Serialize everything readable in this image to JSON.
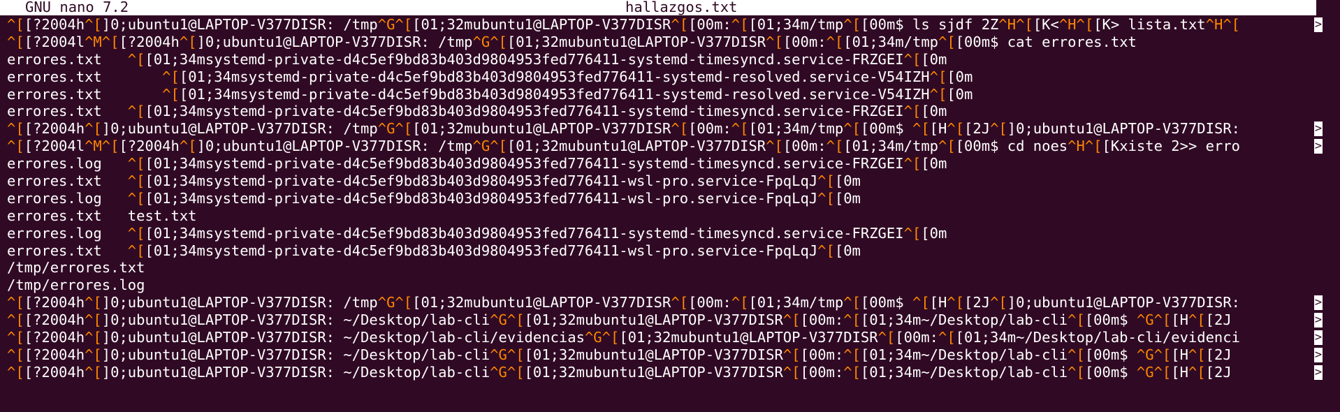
{
  "header": {
    "app": "GNU nano 7.2",
    "filename": "hallazgos.txt"
  },
  "overflow_marker": ">",
  "colors": {
    "background": "#300a24",
    "text": "#ffffff",
    "control_char": "#ff8700",
    "titlebar": "#ffffff"
  },
  "lines": [
    {
      "segments": [
        [
          "c",
          "^["
        ],
        [
          "t",
          "[?2004h"
        ],
        [
          "c",
          "^["
        ],
        [
          "t",
          "]0;ubuntu1@LAPTOP-V377DISR: /tmp"
        ],
        [
          "c",
          "^G^["
        ],
        [
          "t",
          "[01;32mubuntu1@LAPTOP-V377DISR"
        ],
        [
          "c",
          "^["
        ],
        [
          "t",
          "[00m:"
        ],
        [
          "c",
          "^["
        ],
        [
          "t",
          "[01;34m/tmp"
        ],
        [
          "c",
          "^["
        ],
        [
          "t",
          "[00m$ ls sjdf 2Z"
        ],
        [
          "c",
          "^H^["
        ],
        [
          "t",
          "[K<"
        ],
        [
          "c",
          "^H^["
        ],
        [
          "t",
          "[K> lista.txt"
        ],
        [
          "c",
          "^H^["
        ]
      ],
      "more": true
    },
    {
      "segments": [
        [
          "c",
          "^["
        ],
        [
          "t",
          "[?2004l"
        ],
        [
          "c",
          "^M^["
        ],
        [
          "t",
          "[?2004h"
        ],
        [
          "c",
          "^["
        ],
        [
          "t",
          "]0;ubuntu1@LAPTOP-V377DISR: /tmp"
        ],
        [
          "c",
          "^G^["
        ],
        [
          "t",
          "[01;32mubuntu1@LAPTOP-V377DISR"
        ],
        [
          "c",
          "^["
        ],
        [
          "t",
          "[00m:"
        ],
        [
          "c",
          "^["
        ],
        [
          "t",
          "[01;34m/tmp"
        ],
        [
          "c",
          "^["
        ],
        [
          "t",
          "[00m$ cat errores.txt"
        ]
      ],
      "more": false
    },
    {
      "segments": [
        [
          "t",
          "errores.txt   "
        ],
        [
          "c",
          "^["
        ],
        [
          "t",
          "[01;34msystemd-private-d4c5ef9bd83b403d9804953fed776411-systemd-timesyncd.service-FRZGEI"
        ],
        [
          "c",
          "^["
        ],
        [
          "t",
          "[0m"
        ]
      ],
      "more": false
    },
    {
      "segments": [
        [
          "t",
          "errores.txt       "
        ],
        [
          "c",
          "^["
        ],
        [
          "t",
          "[01;34msystemd-private-d4c5ef9bd83b403d9804953fed776411-systemd-resolved.service-V54IZH"
        ],
        [
          "c",
          "^["
        ],
        [
          "t",
          "[0m"
        ]
      ],
      "more": false
    },
    {
      "segments": [
        [
          "t",
          "errores.txt       "
        ],
        [
          "c",
          "^["
        ],
        [
          "t",
          "[01;34msystemd-private-d4c5ef9bd83b403d9804953fed776411-systemd-resolved.service-V54IZH"
        ],
        [
          "c",
          "^["
        ],
        [
          "t",
          "[0m"
        ]
      ],
      "more": false
    },
    {
      "segments": [
        [
          "t",
          "errores.txt   "
        ],
        [
          "c",
          "^["
        ],
        [
          "t",
          "[01;34msystemd-private-d4c5ef9bd83b403d9804953fed776411-systemd-timesyncd.service-FRZGEI"
        ],
        [
          "c",
          "^["
        ],
        [
          "t",
          "[0m"
        ]
      ],
      "more": false
    },
    {
      "segments": [
        [
          "c",
          "^["
        ],
        [
          "t",
          "[?2004h"
        ],
        [
          "c",
          "^["
        ],
        [
          "t",
          "]0;ubuntu1@LAPTOP-V377DISR: /tmp"
        ],
        [
          "c",
          "^G^["
        ],
        [
          "t",
          "[01;32mubuntu1@LAPTOP-V377DISR"
        ],
        [
          "c",
          "^["
        ],
        [
          "t",
          "[00m:"
        ],
        [
          "c",
          "^["
        ],
        [
          "t",
          "[01;34m/tmp"
        ],
        [
          "c",
          "^["
        ],
        [
          "t",
          "[00m$ "
        ],
        [
          "c",
          "^["
        ],
        [
          "t",
          "[H"
        ],
        [
          "c",
          "^["
        ],
        [
          "t",
          "[2J"
        ],
        [
          "c",
          "^["
        ],
        [
          "t",
          "]0;ubuntu1@LAPTOP-V377DISR:"
        ]
      ],
      "more": true
    },
    {
      "segments": [
        [
          "c",
          "^["
        ],
        [
          "t",
          "[?2004l"
        ],
        [
          "c",
          "^M^["
        ],
        [
          "t",
          "[?2004h"
        ],
        [
          "c",
          "^["
        ],
        [
          "t",
          "]0;ubuntu1@LAPTOP-V377DISR: /tmp"
        ],
        [
          "c",
          "^G^["
        ],
        [
          "t",
          "[01;32mubuntu1@LAPTOP-V377DISR"
        ],
        [
          "c",
          "^["
        ],
        [
          "t",
          "[00m:"
        ],
        [
          "c",
          "^["
        ],
        [
          "t",
          "[01;34m/tmp"
        ],
        [
          "c",
          "^["
        ],
        [
          "t",
          "[00m$ cd noes"
        ],
        [
          "c",
          "^H^["
        ],
        [
          "t",
          "[Kxiste 2>> erro"
        ]
      ],
      "more": true
    },
    {
      "segments": [
        [
          "t",
          "errores.log   "
        ],
        [
          "c",
          "^["
        ],
        [
          "t",
          "[01;34msystemd-private-d4c5ef9bd83b403d9804953fed776411-systemd-timesyncd.service-FRZGEI"
        ],
        [
          "c",
          "^["
        ],
        [
          "t",
          "[0m"
        ]
      ],
      "more": false
    },
    {
      "segments": [
        [
          "t",
          "errores.txt   "
        ],
        [
          "c",
          "^["
        ],
        [
          "t",
          "[01;34msystemd-private-d4c5ef9bd83b403d9804953fed776411-wsl-pro.service-FpqLqJ"
        ],
        [
          "c",
          "^["
        ],
        [
          "t",
          "[0m"
        ]
      ],
      "more": false
    },
    {
      "segments": [
        [
          "t",
          "errores.log   "
        ],
        [
          "c",
          "^["
        ],
        [
          "t",
          "[01;34msystemd-private-d4c5ef9bd83b403d9804953fed776411-wsl-pro.service-FpqLqJ"
        ],
        [
          "c",
          "^["
        ],
        [
          "t",
          "[0m"
        ]
      ],
      "more": false
    },
    {
      "segments": [
        [
          "t",
          "errores.txt   test.txt"
        ]
      ],
      "more": false
    },
    {
      "segments": [
        [
          "t",
          "errores.log   "
        ],
        [
          "c",
          "^["
        ],
        [
          "t",
          "[01;34msystemd-private-d4c5ef9bd83b403d9804953fed776411-systemd-timesyncd.service-FRZGEI"
        ],
        [
          "c",
          "^["
        ],
        [
          "t",
          "[0m"
        ]
      ],
      "more": false
    },
    {
      "segments": [
        [
          "t",
          "errores.txt   "
        ],
        [
          "c",
          "^["
        ],
        [
          "t",
          "[01;34msystemd-private-d4c5ef9bd83b403d9804953fed776411-wsl-pro.service-FpqLqJ"
        ],
        [
          "c",
          "^["
        ],
        [
          "t",
          "[0m"
        ]
      ],
      "more": false
    },
    {
      "segments": [
        [
          "t",
          "/tmp/errores.txt"
        ]
      ],
      "more": false
    },
    {
      "segments": [
        [
          "t",
          "/tmp/errores.log"
        ]
      ],
      "more": false
    },
    {
      "segments": [
        [
          "c",
          "^["
        ],
        [
          "t",
          "[?2004h"
        ],
        [
          "c",
          "^["
        ],
        [
          "t",
          "]0;ubuntu1@LAPTOP-V377DISR: /tmp"
        ],
        [
          "c",
          "^G^["
        ],
        [
          "t",
          "[01;32mubuntu1@LAPTOP-V377DISR"
        ],
        [
          "c",
          "^["
        ],
        [
          "t",
          "[00m:"
        ],
        [
          "c",
          "^["
        ],
        [
          "t",
          "[01;34m/tmp"
        ],
        [
          "c",
          "^["
        ],
        [
          "t",
          "[00m$ "
        ],
        [
          "c",
          "^["
        ],
        [
          "t",
          "[H"
        ],
        [
          "c",
          "^["
        ],
        [
          "t",
          "[2J"
        ],
        [
          "c",
          "^["
        ],
        [
          "t",
          "]0;ubuntu1@LAPTOP-V377DISR:"
        ]
      ],
      "more": true
    },
    {
      "segments": [
        [
          "c",
          "^["
        ],
        [
          "t",
          "[?2004h"
        ],
        [
          "c",
          "^["
        ],
        [
          "t",
          "]0;ubuntu1@LAPTOP-V377DISR: ~/Desktop/lab-cli"
        ],
        [
          "c",
          "^G^["
        ],
        [
          "t",
          "[01;32mubuntu1@LAPTOP-V377DISR"
        ],
        [
          "c",
          "^["
        ],
        [
          "t",
          "[00m:"
        ],
        [
          "c",
          "^["
        ],
        [
          "t",
          "[01;34m~/Desktop/lab-cli"
        ],
        [
          "c",
          "^["
        ],
        [
          "t",
          "[00m$ "
        ],
        [
          "c",
          "^G^["
        ],
        [
          "t",
          "[H"
        ],
        [
          "c",
          "^["
        ],
        [
          "t",
          "[2J"
        ]
      ],
      "more": true
    },
    {
      "segments": [
        [
          "c",
          "^["
        ],
        [
          "t",
          "[?2004h"
        ],
        [
          "c",
          "^["
        ],
        [
          "t",
          "]0;ubuntu1@LAPTOP-V377DISR: ~/Desktop/lab-cli/evidencias"
        ],
        [
          "c",
          "^G^["
        ],
        [
          "t",
          "[01;32mubuntu1@LAPTOP-V377DISR"
        ],
        [
          "c",
          "^["
        ],
        [
          "t",
          "[00m:"
        ],
        [
          "c",
          "^["
        ],
        [
          "t",
          "[01;34m~/Desktop/lab-cli/evidenci"
        ]
      ],
      "more": true
    },
    {
      "segments": [
        [
          "c",
          "^["
        ],
        [
          "t",
          "[?2004h"
        ],
        [
          "c",
          "^["
        ],
        [
          "t",
          "]0;ubuntu1@LAPTOP-V377DISR: ~/Desktop/lab-cli"
        ],
        [
          "c",
          "^G^["
        ],
        [
          "t",
          "[01;32mubuntu1@LAPTOP-V377DISR"
        ],
        [
          "c",
          "^["
        ],
        [
          "t",
          "[00m:"
        ],
        [
          "c",
          "^["
        ],
        [
          "t",
          "[01;34m~/Desktop/lab-cli"
        ],
        [
          "c",
          "^["
        ],
        [
          "t",
          "[00m$ "
        ],
        [
          "c",
          "^G^["
        ],
        [
          "t",
          "[H"
        ],
        [
          "c",
          "^["
        ],
        [
          "t",
          "[2J"
        ]
      ],
      "more": true
    },
    {
      "segments": [
        [
          "c",
          "^["
        ],
        [
          "t",
          "[?2004h"
        ],
        [
          "c",
          "^["
        ],
        [
          "t",
          "]0;ubuntu1@LAPTOP-V377DISR: ~/Desktop/lab-cli"
        ],
        [
          "c",
          "^G^["
        ],
        [
          "t",
          "[01;32mubuntu1@LAPTOP-V377DISR"
        ],
        [
          "c",
          "^["
        ],
        [
          "t",
          "[00m:"
        ],
        [
          "c",
          "^["
        ],
        [
          "t",
          "[01;34m~/Desktop/lab-cli"
        ],
        [
          "c",
          "^["
        ],
        [
          "t",
          "[00m$ "
        ],
        [
          "c",
          "^G^["
        ],
        [
          "t",
          "[H"
        ],
        [
          "c",
          "^["
        ],
        [
          "t",
          "[2J"
        ]
      ],
      "more": true
    }
  ]
}
